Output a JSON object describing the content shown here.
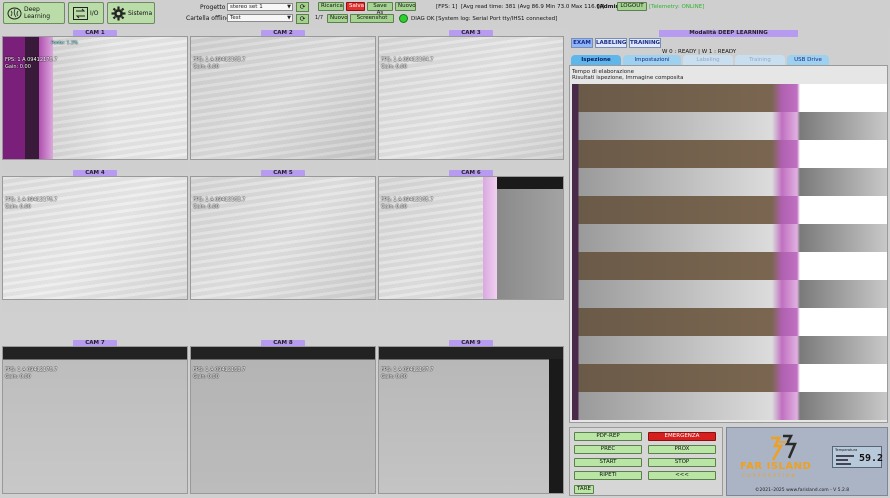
{
  "topbar": {
    "deep_learning_label": "Deep Learning",
    "io_label": "I/O",
    "sistema_label": "Sistema",
    "progetto_label": "Progetto",
    "progetto_value": "stereo set 1",
    "cartella_label": "Cartella offline",
    "cartella_value": "Test",
    "counter": "1/7",
    "ricarica": "Ricarica",
    "salva": "Salva",
    "save_as": "Save As",
    "nuovo": "Nuovo",
    "nuovo2": "Nuovo",
    "screenshot": "Screenshot",
    "diag": "DIAG OK",
    "fps": "[FPS: 1]",
    "avg_time": "[Avg read time: 381 (Avg 86.9 Min 73.0 Max 116.0)]",
    "admin": "[Admin]",
    "logout": "LOGOUT",
    "telemetry": "[Telemetry: ONLINE]",
    "syslog": "[System log: Serial Port tty/IHS1 connected]"
  },
  "cameras": [
    {
      "title": "CAM 1",
      "fps": "FPS: 1 A 09412176.7",
      "gain": "Gain: 0.00",
      "label": "Fonte: 1.3%"
    },
    {
      "title": "CAM 2",
      "fps": "FPS: 1 A 09412163.7",
      "gain": "Gain: 0.00"
    },
    {
      "title": "CAM 3",
      "fps": "FPS: 1 A 09412164.7",
      "gain": "Gain: 0.00"
    },
    {
      "title": "CAM 4",
      "fps": "FPS: 1 A 09412176.7",
      "gain": "Gain: 0.00"
    },
    {
      "title": "CAM 5",
      "fps": "FPS: 1 A 09412163.7",
      "gain": "Gain: 0.00"
    },
    {
      "title": "CAM 6",
      "fps": "FPS: 1 A 09412165.7",
      "gain": "Gain: 0.00"
    },
    {
      "title": "CAM 7",
      "fps": "FPS: 1 A 09412176.7",
      "gain": "Gain: 0.00"
    },
    {
      "title": "CAM 8",
      "fps": "FPS: 1 A 09412163.7",
      "gain": "Gain: 0.00"
    },
    {
      "title": "CAM 9",
      "fps": "FPS: 1 A 09412167.7",
      "gain": "Gain: 0.00"
    }
  ],
  "panel": {
    "title": "Modalità DEEP LEARNING",
    "tabs": [
      "EXAM",
      "LABELING",
      "TRAINING"
    ],
    "ready": "W 0 : READY | W 1 : READY",
    "subtabs": [
      "Ispezione",
      "Impostazioni",
      "Labeling",
      "Training",
      "USB Drive"
    ],
    "tempo": "Tempo di elaborazione",
    "risultati": "Risultati ispezione, Immagine composita"
  },
  "controls": {
    "pdf_rep": "PDF-REP",
    "emergency": "EMERGENZA",
    "prec": "PREC",
    "prox": "PROX",
    "start": "START",
    "stop": "STOP",
    "ripeti": "RIPETI",
    "back": "<<<",
    "tare": "TARE"
  },
  "logo": {
    "brand": "FAR ISLAND",
    "sub": "CORPORATION",
    "copyright": "©2021–2025 www.farisland.com - V 5.2.8",
    "lcd_value": "59.2",
    "lcd_label": "Temperatura"
  },
  "colors": {
    "accent_purple": "#b69bf0",
    "button_green": "#a5d391",
    "save_red": "#e03030",
    "tab_blue": "#5fb6ea",
    "brand_orange": "#f0a020"
  }
}
